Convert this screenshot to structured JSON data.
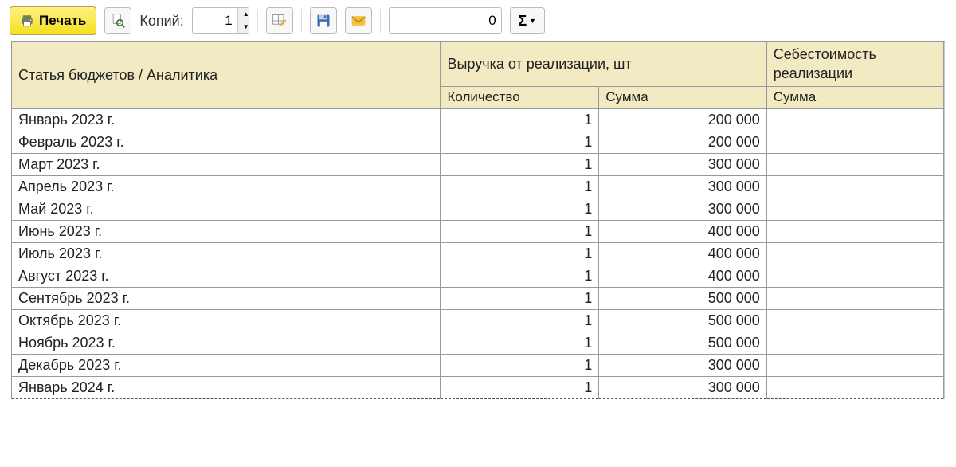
{
  "toolbar": {
    "print_label": "Печать",
    "copies_label": "Копий:",
    "copies_value": "1",
    "second_value": "0",
    "sigma_glyph": "Σ"
  },
  "table": {
    "headers": {
      "budget": "Статья бюджетов / Аналитика",
      "revenue": "Выручка от реализации, шт",
      "cost": "Себестоимость реализации",
      "qty": "Количество",
      "sum": "Сумма",
      "cost_sum": "Сумма"
    },
    "rows": [
      {
        "label": "Январь 2023 г.",
        "qty": "1",
        "sum": "200 000",
        "cost": ""
      },
      {
        "label": "Февраль 2023 г.",
        "qty": "1",
        "sum": "200 000",
        "cost": ""
      },
      {
        "label": "Март 2023 г.",
        "qty": "1",
        "sum": "300 000",
        "cost": ""
      },
      {
        "label": "Апрель 2023 г.",
        "qty": "1",
        "sum": "300 000",
        "cost": ""
      },
      {
        "label": "Май 2023 г.",
        "qty": "1",
        "sum": "300 000",
        "cost": ""
      },
      {
        "label": "Июнь 2023 г.",
        "qty": "1",
        "sum": "400 000",
        "cost": ""
      },
      {
        "label": "Июль 2023 г.",
        "qty": "1",
        "sum": "400 000",
        "cost": ""
      },
      {
        "label": "Август 2023 г.",
        "qty": "1",
        "sum": "400 000",
        "cost": ""
      },
      {
        "label": "Сентябрь 2023 г.",
        "qty": "1",
        "sum": "500 000",
        "cost": ""
      },
      {
        "label": "Октябрь 2023 г.",
        "qty": "1",
        "sum": "500 000",
        "cost": ""
      },
      {
        "label": "Ноябрь 2023 г.",
        "qty": "1",
        "sum": "500 000",
        "cost": ""
      },
      {
        "label": "Декабрь 2023 г.",
        "qty": "1",
        "sum": "300 000",
        "cost": ""
      },
      {
        "label": "Январь 2024 г.",
        "qty": "1",
        "sum": "300 000",
        "cost": ""
      }
    ]
  }
}
